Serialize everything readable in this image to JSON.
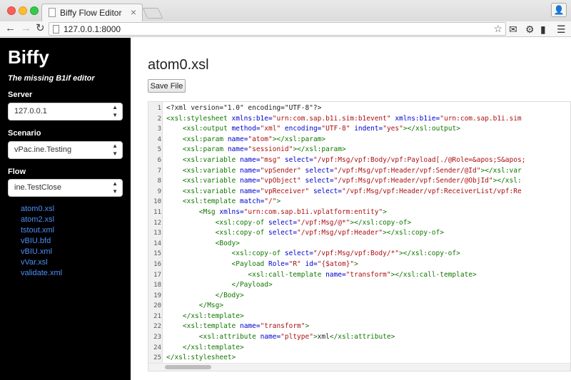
{
  "browser": {
    "tab_title": "Biffy Flow Editor",
    "tab_close": "×",
    "url": "127.0.0.1:8000",
    "star": "☆"
  },
  "sidebar": {
    "brand": "Biffy",
    "tagline": "The missing B1if editor",
    "server_label": "Server",
    "server_value": "127.0.0.1",
    "scenario_label": "Scenario",
    "scenario_value": "vPac.ine.Testing",
    "flow_label": "Flow",
    "flow_value": "ine.TestClose",
    "files": [
      "atom0.xsl",
      "atom2.xsl",
      "tstout.xml",
      "vBIU.bfd",
      "vBIU.xml",
      "vVar.xsl",
      "validate.xml"
    ]
  },
  "main": {
    "title": "atom0.xsl",
    "save_label": "Save File"
  },
  "code": [
    [
      [
        "t",
        "<?xml version=\"1.0\" encoding=\"UTF-8\"?>"
      ]
    ],
    [
      [
        "g",
        "<xsl:stylesheet "
      ],
      [
        "a",
        "xmlns:b1e="
      ],
      [
        "s",
        "\"urn:com.sap.b1i.sim:b1event\""
      ],
      [
        "t",
        " "
      ],
      [
        "a",
        "xmlns:b1ie="
      ],
      [
        "s",
        "\"urn:com.sap.b1i.sim"
      ]
    ],
    [
      [
        "t",
        "    "
      ],
      [
        "g",
        "<xsl:output "
      ],
      [
        "a",
        "method="
      ],
      [
        "s",
        "\"xml\""
      ],
      [
        "t",
        " "
      ],
      [
        "a",
        "encoding="
      ],
      [
        "s",
        "\"UTF-8\""
      ],
      [
        "t",
        " "
      ],
      [
        "a",
        "indent="
      ],
      [
        "s",
        "\"yes\""
      ],
      [
        "g",
        "></xsl:output>"
      ]
    ],
    [
      [
        "t",
        "    "
      ],
      [
        "g",
        "<xsl:param "
      ],
      [
        "a",
        "name="
      ],
      [
        "s",
        "\"atom\""
      ],
      [
        "g",
        "></xsl:param>"
      ]
    ],
    [
      [
        "t",
        "    "
      ],
      [
        "g",
        "<xsl:param "
      ],
      [
        "a",
        "name="
      ],
      [
        "s",
        "\"sessionid\""
      ],
      [
        "g",
        "></xsl:param>"
      ]
    ],
    [
      [
        "t",
        "    "
      ],
      [
        "g",
        "<xsl:variable "
      ],
      [
        "a",
        "name="
      ],
      [
        "s",
        "\"msg\""
      ],
      [
        "t",
        " "
      ],
      [
        "a",
        "select="
      ],
      [
        "s",
        "\"/vpf:Msg/vpf:Body/vpf:Payload[./@Role=&apos;S&apos;"
      ]
    ],
    [
      [
        "t",
        "    "
      ],
      [
        "g",
        "<xsl:variable "
      ],
      [
        "a",
        "name="
      ],
      [
        "s",
        "\"vpSender\""
      ],
      [
        "t",
        " "
      ],
      [
        "a",
        "select="
      ],
      [
        "s",
        "\"/vpf:Msg/vpf:Header/vpf:Sender/@Id\""
      ],
      [
        "g",
        "></xsl:var"
      ]
    ],
    [
      [
        "t",
        "    "
      ],
      [
        "g",
        "<xsl:variable "
      ],
      [
        "a",
        "name="
      ],
      [
        "s",
        "\"vpObject\""
      ],
      [
        "t",
        " "
      ],
      [
        "a",
        "select="
      ],
      [
        "s",
        "\"/vpf:Msg/vpf:Header/vpf:Sender/@ObjId\""
      ],
      [
        "g",
        "></xsl:"
      ]
    ],
    [
      [
        "t",
        "    "
      ],
      [
        "g",
        "<xsl:variable "
      ],
      [
        "a",
        "name="
      ],
      [
        "s",
        "\"vpReceiver\""
      ],
      [
        "t",
        " "
      ],
      [
        "a",
        "select="
      ],
      [
        "s",
        "\"/vpf:Msg/vpf:Header/vpf:ReceiverList/vpf:Re"
      ]
    ],
    [
      [
        "t",
        "    "
      ],
      [
        "g",
        "<xsl:template "
      ],
      [
        "a",
        "match="
      ],
      [
        "s",
        "\"/\""
      ],
      [
        "g",
        ">"
      ]
    ],
    [
      [
        "t",
        "        "
      ],
      [
        "g",
        "<Msg "
      ],
      [
        "a",
        "xmlns="
      ],
      [
        "s",
        "\"urn:com.sap.b1i.vplatform:entity\""
      ],
      [
        "g",
        ">"
      ]
    ],
    [
      [
        "t",
        "            "
      ],
      [
        "g",
        "<xsl:copy-of "
      ],
      [
        "a",
        "select="
      ],
      [
        "s",
        "\"/vpf:Msg/@*\""
      ],
      [
        "g",
        "></xsl:copy-of>"
      ]
    ],
    [
      [
        "t",
        "            "
      ],
      [
        "g",
        "<xsl:copy-of "
      ],
      [
        "a",
        "select="
      ],
      [
        "s",
        "\"/vpf:Msg/vpf:Header\""
      ],
      [
        "g",
        "></xsl:copy-of>"
      ]
    ],
    [
      [
        "t",
        "            "
      ],
      [
        "g",
        "<Body>"
      ]
    ],
    [
      [
        "t",
        "                "
      ],
      [
        "g",
        "<xsl:copy-of "
      ],
      [
        "a",
        "select="
      ],
      [
        "s",
        "\"/vpf:Msg/vpf:Body/*\""
      ],
      [
        "g",
        "></xsl:copy-of>"
      ]
    ],
    [
      [
        "t",
        "                "
      ],
      [
        "g",
        "<Payload "
      ],
      [
        "a",
        "Role="
      ],
      [
        "s",
        "\"R\""
      ],
      [
        "t",
        " "
      ],
      [
        "a",
        "id="
      ],
      [
        "s",
        "\"{$atom}\""
      ],
      [
        "g",
        ">"
      ]
    ],
    [
      [
        "t",
        "                    "
      ],
      [
        "g",
        "<xsl:call-template "
      ],
      [
        "a",
        "name="
      ],
      [
        "s",
        "\"transform\""
      ],
      [
        "g",
        "></xsl:call-template>"
      ]
    ],
    [
      [
        "t",
        "                "
      ],
      [
        "g",
        "</Payload>"
      ]
    ],
    [
      [
        "t",
        "            "
      ],
      [
        "g",
        "</Body>"
      ]
    ],
    [
      [
        "t",
        "        "
      ],
      [
        "g",
        "</Msg>"
      ]
    ],
    [
      [
        "t",
        "    "
      ],
      [
        "g",
        "</xsl:template>"
      ]
    ],
    [
      [
        "t",
        "    "
      ],
      [
        "g",
        "<xsl:template "
      ],
      [
        "a",
        "name="
      ],
      [
        "s",
        "\"transform\""
      ],
      [
        "g",
        ">"
      ]
    ],
    [
      [
        "t",
        "        "
      ],
      [
        "g",
        "<xsl:attribute "
      ],
      [
        "a",
        "name="
      ],
      [
        "s",
        "\"pltype\""
      ],
      [
        "g",
        ">"
      ],
      [
        "t",
        "xml"
      ],
      [
        "g",
        "</xsl:attribute>"
      ]
    ],
    [
      [
        "t",
        "    "
      ],
      [
        "g",
        "</xsl:template>"
      ]
    ],
    [
      [
        "g",
        "</xsl:stylesheet>"
      ]
    ]
  ]
}
